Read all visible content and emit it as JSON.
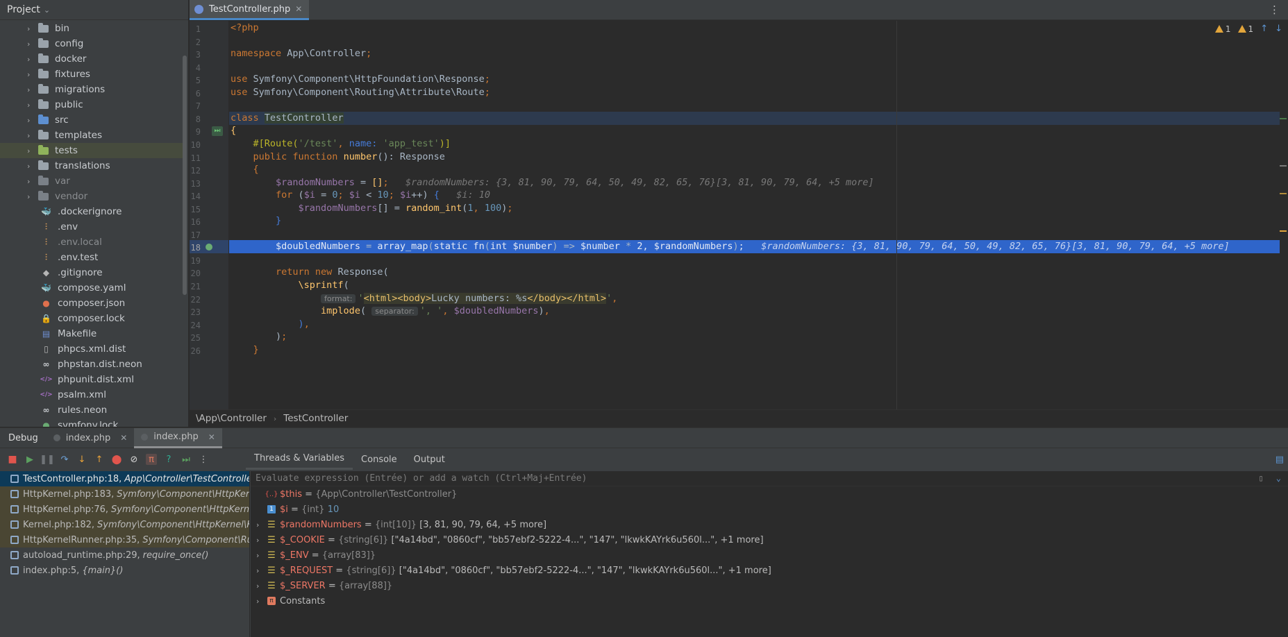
{
  "project_panel": {
    "title": "Project",
    "tree": [
      {
        "label": "bin",
        "kind": "folder",
        "color": "gray",
        "expandable": true
      },
      {
        "label": "config",
        "kind": "folder",
        "color": "gray",
        "expandable": true
      },
      {
        "label": "docker",
        "kind": "folder",
        "color": "gray",
        "expandable": true
      },
      {
        "label": "fixtures",
        "kind": "folder",
        "color": "gray",
        "expandable": true
      },
      {
        "label": "migrations",
        "kind": "folder",
        "color": "gray",
        "expandable": true
      },
      {
        "label": "public",
        "kind": "folder",
        "color": "gray",
        "expandable": true
      },
      {
        "label": "src",
        "kind": "folder",
        "color": "blue",
        "expandable": true
      },
      {
        "label": "templates",
        "kind": "folder",
        "color": "gray",
        "expandable": true
      },
      {
        "label": "tests",
        "kind": "folder",
        "color": "green",
        "expandable": true,
        "selected": true
      },
      {
        "label": "translations",
        "kind": "folder",
        "color": "gray",
        "expandable": true
      },
      {
        "label": "var",
        "kind": "folder",
        "color": "dim",
        "expandable": true,
        "dim": true
      },
      {
        "label": "vendor",
        "kind": "folder",
        "color": "dim",
        "expandable": true,
        "dim": true
      },
      {
        "label": ".dockerignore",
        "kind": "file",
        "icon": "docker-icon",
        "glyph": "🐳",
        "glyph_color": "#8a9bb0"
      },
      {
        "label": ".env",
        "kind": "file",
        "icon": "env-icon",
        "glyph": "⫶",
        "glyph_color": "#d39a5b"
      },
      {
        "label": ".env.local",
        "kind": "file",
        "icon": "env-icon",
        "glyph": "⫶",
        "glyph_color": "#d39a5b",
        "dim": true
      },
      {
        "label": ".env.test",
        "kind": "file",
        "icon": "env-icon",
        "glyph": "⫶",
        "glyph_color": "#d39a5b"
      },
      {
        "label": ".gitignore",
        "kind": "file",
        "icon": "git-icon",
        "glyph": "◆",
        "glyph_color": "#b5b5b5"
      },
      {
        "label": "compose.yaml",
        "kind": "file",
        "icon": "docker-compose-icon",
        "glyph": "🐳",
        "glyph_color": "#4a90d9"
      },
      {
        "label": "composer.json",
        "kind": "file",
        "icon": "composer-icon",
        "glyph": "●",
        "glyph_color": "#e0704d"
      },
      {
        "label": "composer.lock",
        "kind": "file",
        "icon": "lock-icon",
        "glyph": "🔒",
        "glyph_color": "#e0554d"
      },
      {
        "label": "Makefile",
        "kind": "file",
        "icon": "makefile-icon",
        "glyph": "▤",
        "glyph_color": "#6f8fd3"
      },
      {
        "label": "phpcs.xml.dist",
        "kind": "file",
        "icon": "file-icon",
        "glyph": "▯",
        "glyph_color": "#b5b5b5"
      },
      {
        "label": "phpstan.dist.neon",
        "kind": "file",
        "icon": "neon-icon",
        "glyph": "∞",
        "glyph_color": "#c9ccd0"
      },
      {
        "label": "phpunit.dist.xml",
        "kind": "file",
        "icon": "xml-icon",
        "glyph": "</>",
        "glyph_color": "#a970c9"
      },
      {
        "label": "psalm.xml",
        "kind": "file",
        "icon": "xml-icon",
        "glyph": "</>",
        "glyph_color": "#a970c9"
      },
      {
        "label": "rules.neon",
        "kind": "file",
        "icon": "neon-icon",
        "glyph": "∞",
        "glyph_color": "#c9ccd0"
      },
      {
        "label": "symfony.lock",
        "kind": "file",
        "icon": "symfony-icon",
        "glyph": "●",
        "glyph_color": "#6aab73"
      }
    ]
  },
  "editor": {
    "tab_label": "TestController.php",
    "breadcrumb": [
      "\\App\\Controller",
      "TestController"
    ],
    "warnings": {
      "count_a": "1",
      "count_b": "1"
    },
    "lines": [
      {
        "n": 1,
        "html": "<span class=\"kw\">&lt;?php</span>"
      },
      {
        "n": 2,
        "html": ""
      },
      {
        "n": 3,
        "html": "<span class=\"kw\">namespace</span> <span class=\"cl\">App\\Controller</span><span class=\"kw\">;</span>"
      },
      {
        "n": 4,
        "html": ""
      },
      {
        "n": 5,
        "html": "<span class=\"kw\">use</span> <span class=\"cl\">Symfony\\Component\\HttpFoundation\\Response</span><span class=\"kw\">;</span>"
      },
      {
        "n": 6,
        "html": "<span class=\"kw\">use</span> <span class=\"cl\">Symfony\\Component\\Routing\\Attribute\\Route</span><span class=\"kw\">;</span>"
      },
      {
        "n": 7,
        "html": ""
      },
      {
        "n": 8,
        "html": "<span class=\"kw\">class</span> <span class=\"cls-hl\">TestController</span>",
        "cur": true
      },
      {
        "n": 9,
        "html": "<span class=\"fn\">{</span>"
      },
      {
        "n": 10,
        "html": "    <span class=\"at\">#[Route(</span><span class=\"st\">'/test'</span><span class=\"kw\">,</span> <span class=\"nm\">name:</span> <span class=\"st\">'app_test'</span><span class=\"at\">)]</span>"
      },
      {
        "n": 11,
        "html": "    <span class=\"kw\">public function</span> <span class=\"fn\">number</span>(): <span class=\"cl\">Response</span>"
      },
      {
        "n": 12,
        "html": "    <span class=\"kw\">{</span>"
      },
      {
        "n": 13,
        "html": "        <span class=\"vr\">$randomNumbers</span> = <span class=\"fn\">[]</span><span class=\"kw\">;</span>   <span class=\"hint\">$randomNumbers: {3, 81, 90, 79, 64, 50, 49, 82, 65, 76}[3, 81, 90, 79, 64, +5 more]</span>"
      },
      {
        "n": 14,
        "html": "        <span class=\"kw\">for</span> (<span class=\"vr\">$i</span> = <span class=\"nu\">0</span><span class=\"kw\">;</span> <span class=\"vr\">$i</span> &lt; <span class=\"nu\">10</span><span class=\"kw\">;</span> <span class=\"vr\">$i</span>++) <span class=\"nm\">{</span>   <span class=\"hint\">$i: 10</span>"
      },
      {
        "n": 15,
        "html": "            <span class=\"vr\">$randomNumbers</span>[] = <span class=\"fn\">random_int</span>(<span class=\"nu\">1</span><span class=\"kw\">,</span> <span class=\"nu\">100</span>)<span class=\"kw\">;</span>"
      },
      {
        "n": 16,
        "html": "        <span class=\"nm\">}</span>"
      },
      {
        "n": 17,
        "html": ""
      },
      {
        "n": 18,
        "html": "        <span class=\"vr\">$doubledNumbers</span> = <span class=\"fn\">array_map</span>(<span class=\"kw\">static fn</span>(<span class=\"kw\">int</span> <span class=\"vr\">$number</span>) =&gt; <span class=\"vr\">$number</span> * <span class=\"nu\">2</span><span class=\"kw\">,</span> <span class=\"vr\">$randomNumbers</span>)<span class=\"kw\">;</span>   <span class=\"hint\">$randomNumbers: {3, 81, 90, 79, 64, 50, 49, 82, 65, 76}[3, 81, 90, 79, 64, +5 more]</span>",
        "exec": true
      },
      {
        "n": 19,
        "html": ""
      },
      {
        "n": 20,
        "html": "        <span class=\"kw\">return new</span> <span class=\"cl\">Response</span>("
      },
      {
        "n": 21,
        "html": "            <span class=\"fn\">\\sprintf</span>("
      },
      {
        "n": 22,
        "html": "                <span class=\"param-hint\">format:</span><span class=\"st\">'</span><span class=\"htm-bg\"><span class=\"htm\">&lt;html&gt;</span><span class=\"htm\">&lt;body&gt;</span><span class=\"cl\">Lucky numbers: %s</span><span class=\"htm\">&lt;/body&gt;</span><span class=\"htm\">&lt;/html&gt;</span></span><span class=\"st\">'</span><span class=\"kw\">,</span>"
      },
      {
        "n": 23,
        "html": "                <span class=\"fn\">implode</span>( <span class=\"param-hint\">separator:</span><span class=\"st\">', '</span><span class=\"kw\">,</span> <span class=\"vr\">$doubledNumbers</span>)<span class=\"kw\">,</span>"
      },
      {
        "n": 24,
        "html": "            <span class=\"nm\">)</span><span class=\"kw\">,</span>"
      },
      {
        "n": 25,
        "html": "        )<span class=\"kw\">;</span>"
      },
      {
        "n": 26,
        "html": "    <span class=\"kw\">}</span>"
      }
    ]
  },
  "debug": {
    "title": "Debug",
    "session_tabs": [
      "index.php",
      "index.php"
    ],
    "subtabs": [
      "Threads & Variables",
      "Console",
      "Output"
    ],
    "watch_placeholder": "Evaluate expression (Entrée) or add a watch (Ctrl+Maj+Entrée)",
    "frames": [
      {
        "file": "TestController.php:18,",
        "where": "App\\Controller\\TestController",
        "selected": true
      },
      {
        "file": "HttpKernel.php:183,",
        "where": "Symfony\\Component\\HttpKernel\\HttpKernel",
        "lib": true
      },
      {
        "file": "HttpKernel.php:76,",
        "where": "Symfony\\Component\\HttpKernel\\HttpKernel",
        "lib": true
      },
      {
        "file": "Kernel.php:182,",
        "where": "Symfony\\Component\\HttpKernel\\Kernel",
        "lib": true
      },
      {
        "file": "HttpKernelRunner.php:35,",
        "where": "Symfony\\Component\\Runtime\\Runner",
        "lib": true
      },
      {
        "file": "autoload_runtime.php:29,",
        "where": "require_once()"
      },
      {
        "file": "index.php:5,",
        "where": "{main}()"
      }
    ],
    "variables": [
      {
        "name": "$this",
        "type": "{App\\Controller\\TestController}",
        "value": "",
        "icon": "obj",
        "expandable": false
      },
      {
        "name": "$i",
        "type": "{int}",
        "value": "10",
        "icon": "int",
        "expandable": false,
        "numeric": true
      },
      {
        "name": "$randomNumbers",
        "type": "{int[10]}",
        "value": "[3, 81, 90, 79, 64, +5 more]",
        "icon": "arr",
        "expandable": true
      },
      {
        "name": "$_COOKIE",
        "type": "{string[6]}",
        "value": "[\"4a14bd\", \"0860cf\", \"bb57ebf2-5222-4...\", \"147\", \"lkwkKAYrk6u560l...\", +1 more]",
        "icon": "arr",
        "expandable": true
      },
      {
        "name": "$_ENV",
        "type": "{array[83]}",
        "value": "",
        "icon": "arr",
        "expandable": true
      },
      {
        "name": "$_REQUEST",
        "type": "{string[6]}",
        "value": "[\"4a14bd\", \"0860cf\", \"bb57ebf2-5222-4...\", \"147\", \"lkwkKAYrk6u560l...\", +1 more]",
        "icon": "arr",
        "expandable": true
      },
      {
        "name": "$_SERVER",
        "type": "{array[88]}",
        "value": "",
        "icon": "arr",
        "expandable": true
      },
      {
        "name": "Constants",
        "type": "",
        "value": "",
        "icon": "const",
        "expandable": true,
        "plain": true
      }
    ]
  }
}
